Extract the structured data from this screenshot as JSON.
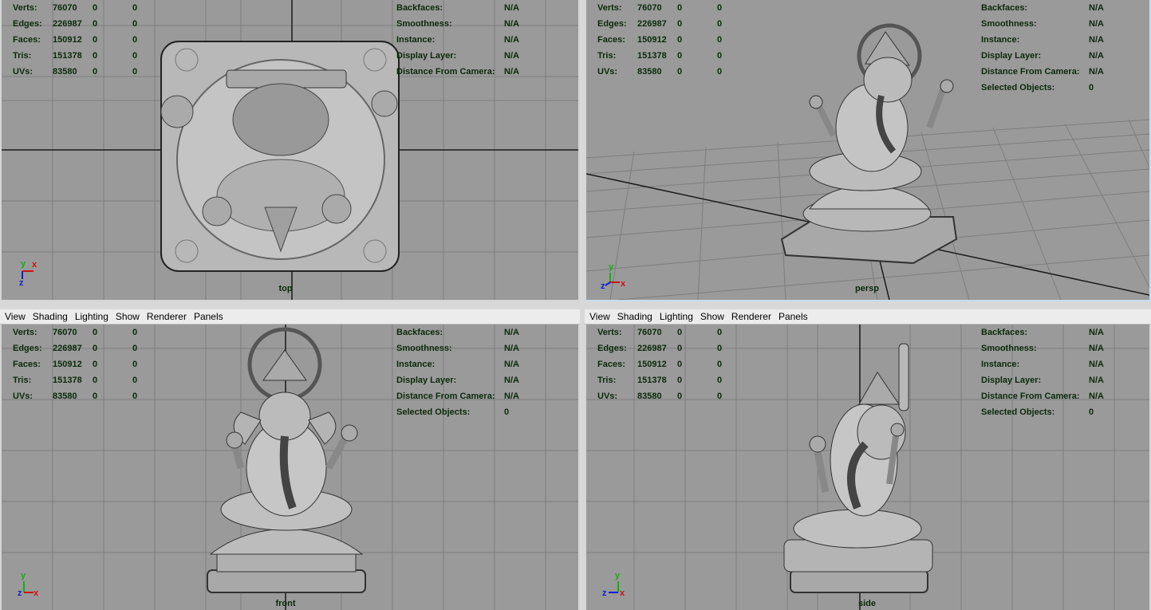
{
  "menu": [
    "View",
    "Shading",
    "Lighting",
    "Show",
    "Renderer",
    "Panels"
  ],
  "stats_left": [
    {
      "label": "Verts:",
      "v1": "76070",
      "v2": "0",
      "v3": "0"
    },
    {
      "label": "Edges:",
      "v1": "226987",
      "v2": "0",
      "v3": "0"
    },
    {
      "label": "Faces:",
      "v1": "150912",
      "v2": "0",
      "v3": "0"
    },
    {
      "label": "Tris:",
      "v1": "151378",
      "v2": "0",
      "v3": "0"
    },
    {
      "label": "UVs:",
      "v1": "83580",
      "v2": "0",
      "v3": "0"
    }
  ],
  "stats_right": [
    {
      "label": "Backfaces:",
      "value": "N/A"
    },
    {
      "label": "Smoothness:",
      "value": "N/A"
    },
    {
      "label": "Instance:",
      "value": "N/A"
    },
    {
      "label": "Display Layer:",
      "value": "N/A"
    },
    {
      "label": "Distance From Camera:",
      "value": "N/A"
    },
    {
      "label": "Selected Objects:",
      "value": "0"
    }
  ],
  "viewports": {
    "top": {
      "camera": "top"
    },
    "persp": {
      "camera": "persp"
    },
    "front": {
      "camera": "front"
    },
    "side": {
      "camera": "side"
    }
  },
  "axis_labels": {
    "x": "x",
    "y": "y",
    "z": "z"
  },
  "colors": {
    "viewport_bg": "#9a9a9a",
    "grid_line": "#7e7e7e",
    "grid_axis": "#1a1a1a",
    "hud_text": "#0a2a0a",
    "axis_x": "#d01010",
    "axis_y": "#10b010",
    "axis_z": "#1020d0",
    "model": "#bdbdbd"
  }
}
